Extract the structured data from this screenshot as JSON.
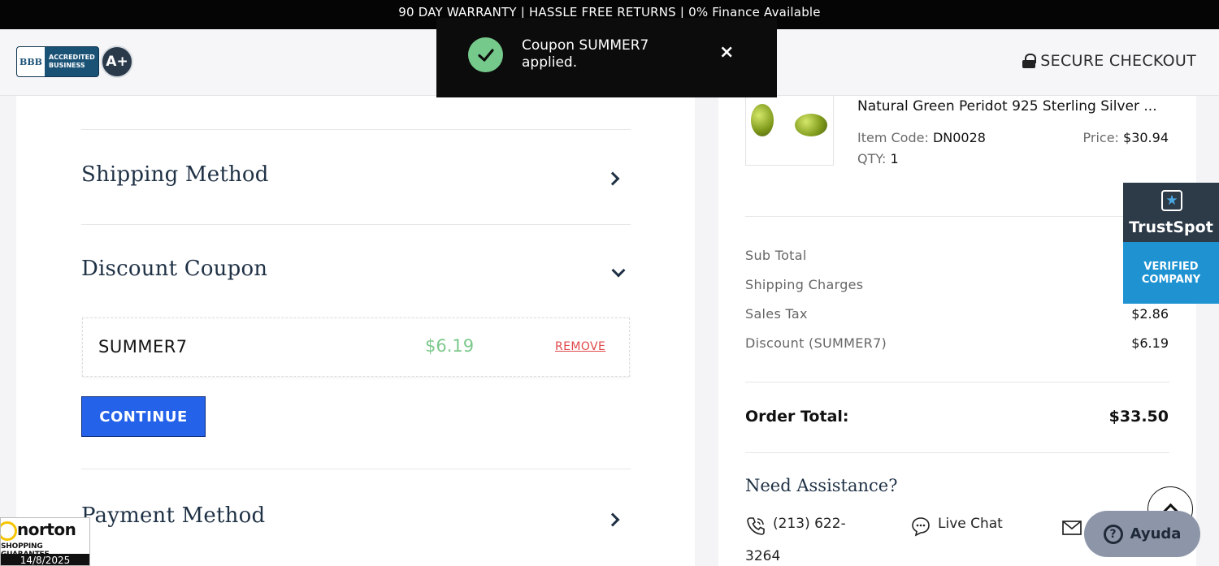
{
  "topbar": {
    "text": "90 DAY WARRANTY | HASSLE FREE RETURNS | 0% Finance Available"
  },
  "header": {
    "bbb": {
      "seal": "BBB",
      "line1": "ACCREDITED",
      "line2": "BUSINESS",
      "rating": "A+"
    },
    "secure_checkout": "SECURE CHECKOUT"
  },
  "toast": {
    "message": "Coupon SUMMER7 applied.",
    "close": "×"
  },
  "checkout": {
    "shipping_method": "Shipping Method",
    "discount_coupon": "Discount Coupon",
    "coupon": {
      "code": "SUMMER7",
      "amount": "$6.19",
      "remove": "REMOVE"
    },
    "continue_label": "CONTINUE",
    "payment_method": "Payment Method"
  },
  "order": {
    "product": {
      "name": "Natural Green Peridot 925 Sterling Silver ...",
      "item_code_label": "Item Code:",
      "item_code": "DN0028",
      "price_label": "Price:",
      "price": "$30.94",
      "qty_label": "QTY:",
      "qty": "1"
    },
    "summary": [
      {
        "label": "Sub Total",
        "value": ""
      },
      {
        "label": "Shipping Charges",
        "value": ""
      },
      {
        "label": "Sales Tax",
        "value": "$2.86"
      },
      {
        "label": "Discount (SUMMER7)",
        "value": "$6.19"
      }
    ],
    "total_label": "Order Total:",
    "total_value": "$33.50",
    "assist_title": "Need Assistance?",
    "phone_line1": "(213) 622-",
    "phone_line2": "3264",
    "live_chat": "Live Chat"
  },
  "trustspot": {
    "name": "TrustSpot",
    "line1": "VERIFIED",
    "line2": "COMPANY"
  },
  "norton": {
    "name": "norton",
    "sub": "SHOPPING GUARANTEE",
    "date": "14/8/2025"
  },
  "help": {
    "label": "Ayuda"
  },
  "colors": {
    "accent": "#2362e9",
    "success": "#75c98b",
    "danger": "#e0484b",
    "heading": "#1f3145"
  }
}
